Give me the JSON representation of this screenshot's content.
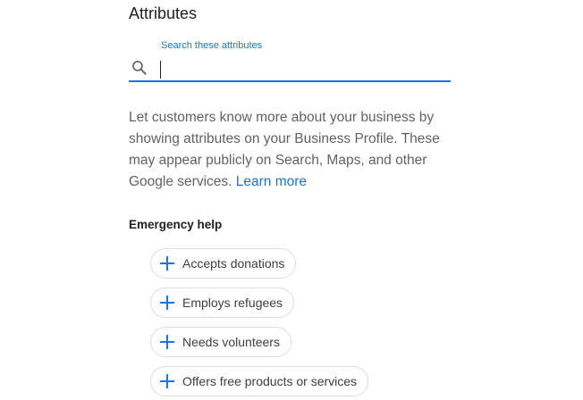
{
  "header": {
    "title": "Attributes"
  },
  "search": {
    "label": "Search these attributes",
    "value": "",
    "icon": "search-icon"
  },
  "description": {
    "text": "Let customers know more about your business by showing attributes on your Business Profile. These may appear publicly on Search, Maps, and other Google services.",
    "link_label": "Learn more"
  },
  "section": {
    "title": "Emergency help",
    "items": [
      {
        "label": "Accepts donations",
        "icon": "plus-icon"
      },
      {
        "label": "Employs refugees",
        "icon": "plus-icon"
      },
      {
        "label": "Needs volunteers",
        "icon": "plus-icon"
      },
      {
        "label": "Offers free products or services",
        "icon": "plus-icon"
      }
    ]
  },
  "colors": {
    "accent": "#1a73e8",
    "text_primary": "#202124",
    "text_secondary": "#5f6368",
    "chip_border": "#dadce0"
  }
}
